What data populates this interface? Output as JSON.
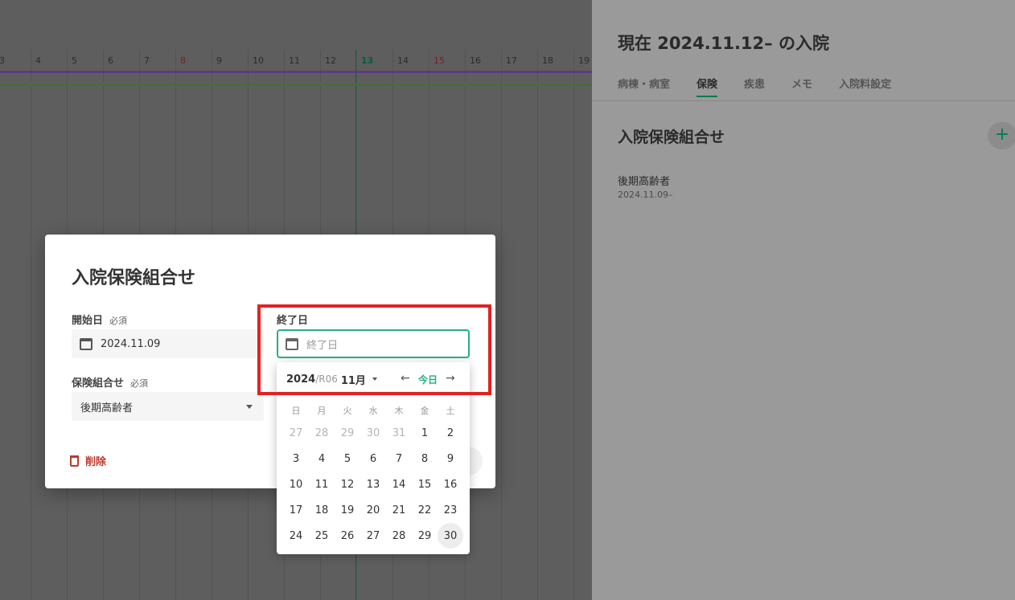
{
  "timeline": {
    "days": [
      {
        "label": "3",
        "kind": "normal"
      },
      {
        "label": "4",
        "kind": "normal"
      },
      {
        "label": "5",
        "kind": "normal"
      },
      {
        "label": "6",
        "kind": "normal"
      },
      {
        "label": "7",
        "kind": "normal"
      },
      {
        "label": "8",
        "kind": "weekend"
      },
      {
        "label": "9",
        "kind": "normal"
      },
      {
        "label": "10",
        "kind": "normal"
      },
      {
        "label": "11",
        "kind": "normal"
      },
      {
        "label": "12",
        "kind": "normal"
      },
      {
        "label": "13",
        "kind": "today"
      },
      {
        "label": "14",
        "kind": "normal"
      },
      {
        "label": "15",
        "kind": "weekend"
      },
      {
        "label": "16",
        "kind": "normal"
      },
      {
        "label": "17",
        "kind": "normal"
      },
      {
        "label": "18",
        "kind": "normal"
      },
      {
        "label": "19",
        "kind": "normal"
      }
    ],
    "bars": [
      {
        "color": "#5b3c7c"
      },
      {
        "color": "#4c6b3a"
      }
    ]
  },
  "right_panel": {
    "title": "現在 2024.11.12– の入院",
    "tabs": [
      {
        "label": "病棟・病室",
        "active": false
      },
      {
        "label": "保険",
        "active": true
      },
      {
        "label": "疾患",
        "active": false
      },
      {
        "label": "メモ",
        "active": false
      },
      {
        "label": "入院料設定",
        "active": false
      }
    ],
    "section_title": "入院保険組合せ",
    "add_icon": "+",
    "item": {
      "name": "後期高齢者",
      "date": "2024.11.09–"
    }
  },
  "dialog": {
    "title": "入院保険組合せ",
    "start_label": "開始日",
    "start_required": "必須",
    "start_value": "2024.11.09",
    "end_label": "終了日",
    "end_placeholder": "終了日",
    "combo_label": "保険組合せ",
    "combo_required": "必須",
    "combo_value": "後期高齢者",
    "delete_label": "削除"
  },
  "picker": {
    "year": "2024",
    "era": "/R06",
    "month": "11月",
    "prev_icon": "←",
    "today_label": "今日",
    "next_icon": "→",
    "weekdays": [
      "日",
      "月",
      "火",
      "水",
      "木",
      "金",
      "土"
    ],
    "weeks": [
      [
        {
          "d": "27",
          "o": true
        },
        {
          "d": "28",
          "o": true
        },
        {
          "d": "29",
          "o": true
        },
        {
          "d": "30",
          "o": true
        },
        {
          "d": "31",
          "o": true
        },
        {
          "d": "1",
          "o": false
        },
        {
          "d": "2",
          "o": false
        }
      ],
      [
        {
          "d": "3",
          "o": false
        },
        {
          "d": "4",
          "o": false
        },
        {
          "d": "5",
          "o": false
        },
        {
          "d": "6",
          "o": false
        },
        {
          "d": "7",
          "o": false
        },
        {
          "d": "8",
          "o": false
        },
        {
          "d": "9",
          "o": false
        }
      ],
      [
        {
          "d": "10",
          "o": false
        },
        {
          "d": "11",
          "o": false
        },
        {
          "d": "12",
          "o": false
        },
        {
          "d": "13",
          "o": false
        },
        {
          "d": "14",
          "o": false
        },
        {
          "d": "15",
          "o": false
        },
        {
          "d": "16",
          "o": false
        }
      ],
      [
        {
          "d": "17",
          "o": false
        },
        {
          "d": "18",
          "o": false
        },
        {
          "d": "19",
          "o": false
        },
        {
          "d": "20",
          "o": false
        },
        {
          "d": "21",
          "o": false
        },
        {
          "d": "22",
          "o": false
        },
        {
          "d": "23",
          "o": false
        }
      ],
      [
        {
          "d": "24",
          "o": false
        },
        {
          "d": "25",
          "o": false
        },
        {
          "d": "26",
          "o": false
        },
        {
          "d": "27",
          "o": false
        },
        {
          "d": "28",
          "o": false
        },
        {
          "d": "29",
          "o": false
        },
        {
          "d": "30",
          "o": false,
          "hover": true
        }
      ]
    ]
  },
  "colors": {
    "accent": "#23b083",
    "danger": "#c0392b",
    "highlight": "#e32121"
  }
}
